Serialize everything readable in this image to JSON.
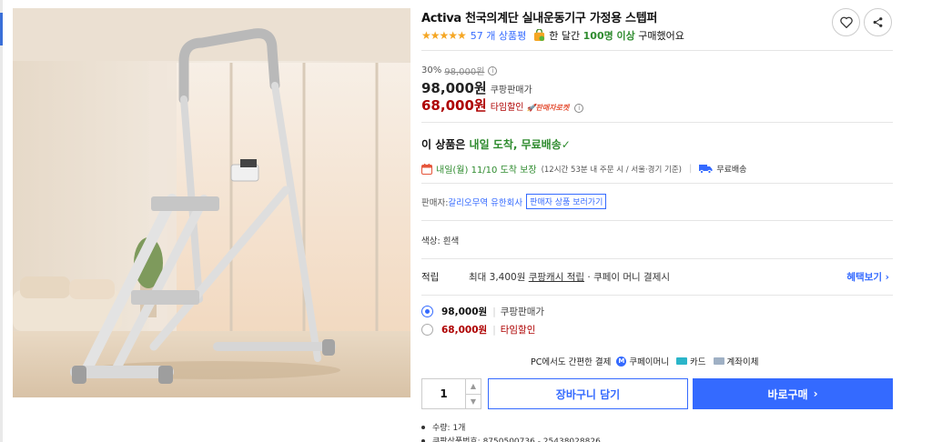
{
  "product": {
    "title": "Activa 천국의계단 실내운동기구 가정용 스텝퍼",
    "stars": "★★★★★",
    "review_count": "57 개 상품평",
    "purchase_prefix": "한 달간",
    "purchase_highlight": "100명 이상",
    "purchase_suffix": "구매했어요"
  },
  "pricing": {
    "discount_rate": "30%",
    "original_price": "98,000원",
    "price": "98,000원",
    "price_tag": "쿠팡판매가",
    "sale_price": "68,000원",
    "sale_tag": "타임할인",
    "rocket_label": "판매자로켓"
  },
  "delivery": {
    "headline_prefix": "이 상품은",
    "headline_highlight": "내일 도착, 무료배송",
    "check": "✓",
    "date": "내일(월) 11/10 도착 보장",
    "condition": "(12시간 53분 내 주문 시 / 서울·경기 기준)",
    "free_shipping": "무료배송"
  },
  "seller": {
    "label": "판매자:",
    "name": "갈리오무역 유한회사",
    "more_button": "판매자 상품 보러가기"
  },
  "color": "색상: 흰색",
  "points": {
    "label": "적립",
    "desc_prefix": "최대 3,400원",
    "desc_link": "쿠팡캐시 적립",
    "desc_suffix": "· 쿠페이 머니 결제시",
    "benefit_link": "혜택보기 ›"
  },
  "options": [
    {
      "amount": "98,000원",
      "tag": "쿠팡판매가",
      "selected": true
    },
    {
      "amount": "68,000원",
      "tag": "타임할인",
      "selected": false
    }
  ],
  "payment": {
    "label": "PC에서도 간편한 결제",
    "m_badge": "M",
    "methods": [
      "쿠페이머니",
      "카드",
      "계좌이체"
    ]
  },
  "purchase": {
    "quantity": "1",
    "cart_button": "장바구니 담기",
    "buy_button": "바로구매",
    "buy_chevron": "›"
  },
  "details": [
    "수량: 1개",
    "쿠팡상품번호: 8750500736 - 25438028826"
  ],
  "icons": {
    "heart": "heart-icon",
    "share": "share-icon",
    "bag": "shopping-bag-icon",
    "calendar": "calendar-icon",
    "truck": "truck-icon",
    "info": "info-icon"
  },
  "colors": {
    "accent_blue": "#346aff",
    "sale_red": "#ae0000",
    "delivery_green": "#2e8b2e",
    "star_gold": "#f5a623"
  }
}
